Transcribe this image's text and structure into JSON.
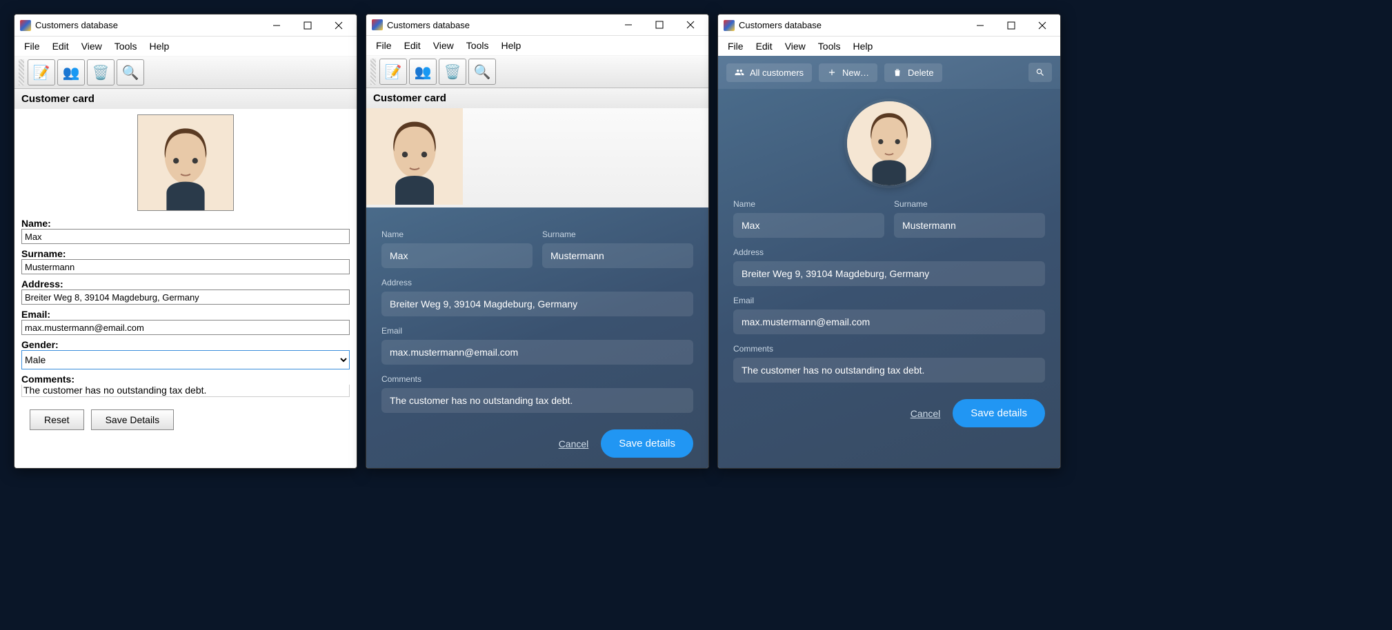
{
  "app_title": "Customers database",
  "menu": {
    "file": "File",
    "edit": "Edit",
    "view": "View",
    "tools": "Tools",
    "help": "Help"
  },
  "classic": {
    "section_label": "Customer card",
    "labels": {
      "name": "Name:",
      "surname": "Surname:",
      "address": "Address:",
      "email": "Email:",
      "gender": "Gender:",
      "comments": "Comments:"
    },
    "values": {
      "name": "Max",
      "surname": "Mustermann",
      "address": "Breiter Weg 8, 39104 Magdeburg, Germany",
      "email": "max.mustermann@email.com",
      "gender": "Male",
      "comments": "The customer has no outstanding tax debt."
    },
    "buttons": {
      "reset": "Reset",
      "save": "Save Details"
    },
    "toolbar_icons": [
      "notepad",
      "people",
      "trash",
      "search"
    ]
  },
  "modern1": {
    "labels": {
      "name": "Name",
      "surname": "Surname",
      "address": "Address",
      "email": "Email",
      "comments": "Comments"
    },
    "values": {
      "name": "Max",
      "surname": "Mustermann",
      "address": "Breiter Weg 9, 39104 Magdeburg, Germany",
      "email": "max.mustermann@email.com",
      "comments": "The customer has no outstanding tax debt."
    },
    "buttons": {
      "cancel": "Cancel",
      "save": "Save details"
    }
  },
  "modern2": {
    "toolbar": {
      "all": "All customers",
      "new": "New…",
      "delete": "Delete"
    },
    "labels": {
      "name": "Name",
      "surname": "Surname",
      "address": "Address",
      "email": "Email",
      "comments": "Comments"
    },
    "values": {
      "name": "Max",
      "surname": "Mustermann",
      "address": "Breiter Weg 9, 39104 Magdeburg, Germany",
      "email": "max.mustermann@email.com",
      "comments": "The customer has no outstanding tax debt."
    },
    "buttons": {
      "cancel": "Cancel",
      "save": "Save details"
    }
  }
}
